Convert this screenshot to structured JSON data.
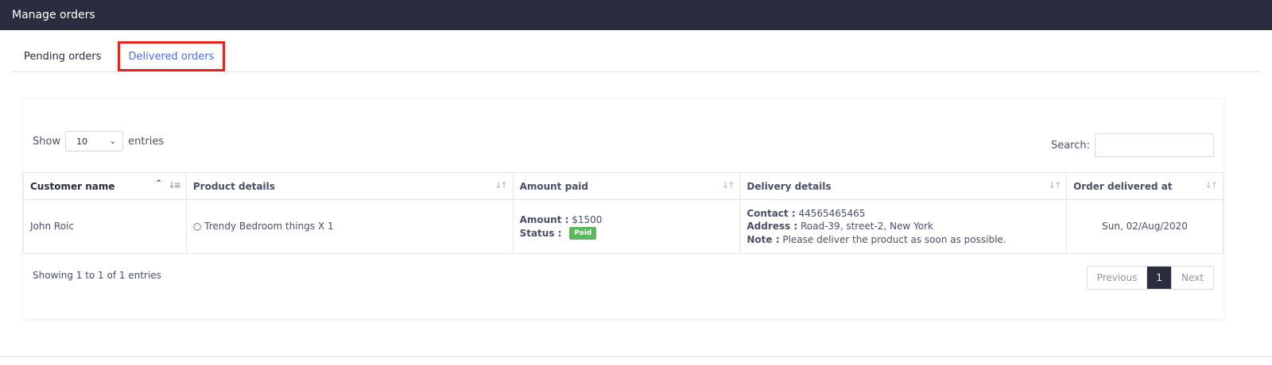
{
  "header": {
    "title": "Manage orders"
  },
  "tabs": [
    {
      "label": "Pending orders"
    },
    {
      "label": "Delivered orders"
    }
  ],
  "controls": {
    "show_label": "Show",
    "page_size": "10",
    "entries_label": "entries",
    "search_label": "Search:",
    "search_value": ""
  },
  "table": {
    "columns": [
      "Customer name",
      "Product details",
      "Amount paid",
      "Delivery details",
      "Order delivered at"
    ],
    "rows": [
      {
        "customer": "John Roic",
        "product": "○ Trendy Bedroom things X 1",
        "amount_label": "Amount :",
        "amount_value": "$1500",
        "status_label": "Status :",
        "status_badge": "Paid",
        "contact_label": "Contact :",
        "contact_value": "44565465465",
        "address_label": "Address :",
        "address_value": "Road-39, street-2, New York",
        "note_label": "Note :",
        "note_value": "Please deliver the product as soon as possible.",
        "delivered_at": "Sun, 02/Aug/2020"
      }
    ]
  },
  "footer": {
    "info": "Showing 1 to 1 of 1 entries",
    "prev": "Previous",
    "current_page": "1",
    "next": "Next"
  },
  "colors": {
    "topbar": "#2a2d3e",
    "active_tab": "#4f6bed",
    "highlight": "#e8231b",
    "paid_badge": "#5cb85c"
  }
}
